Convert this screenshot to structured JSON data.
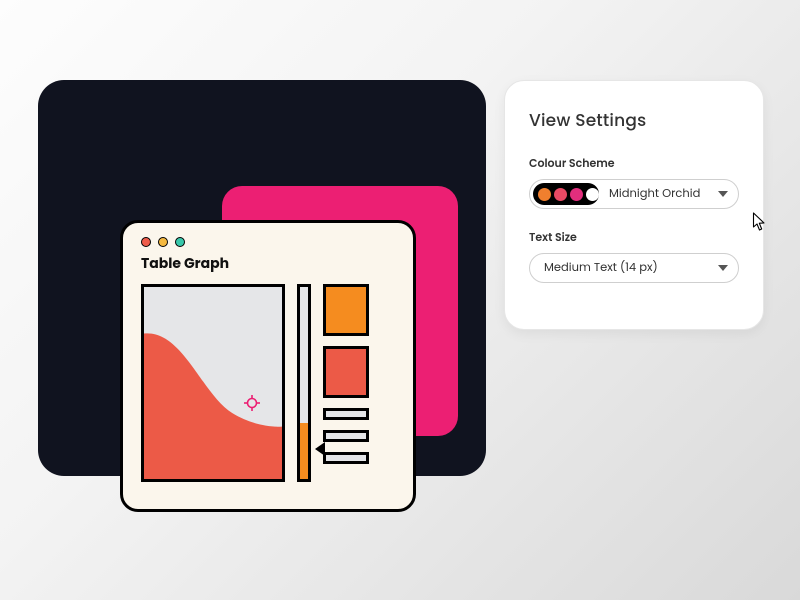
{
  "preview": {
    "window_title": "Table Graph",
    "swatch_colors": {
      "primary": "#f58c1f",
      "secondary": "#ec5a47"
    },
    "slider_fill_pct": 28
  },
  "settings": {
    "title": "View Settings",
    "colour_scheme": {
      "label": "Colour Scheme",
      "selected": "Midnight Orchid",
      "swatches": [
        "#f07f2e",
        "#e84a64",
        "#e22e7d",
        "#ffffff"
      ]
    },
    "text_size": {
      "label": "Text Size",
      "selected": "Medium Text (14 px)"
    }
  }
}
